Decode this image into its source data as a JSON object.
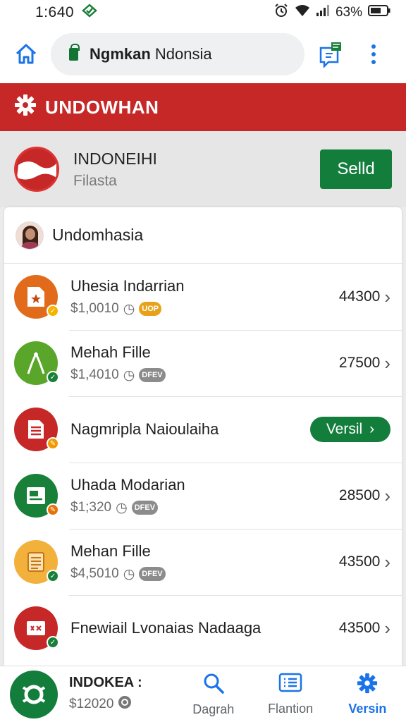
{
  "status_bar": {
    "time": "1:640",
    "battery": "63%",
    "icons": [
      "wifi-icon",
      "signal-icon",
      "alarm-icon",
      "battery-icon"
    ]
  },
  "browser": {
    "url_bold": "Ngmkan",
    "url_rest": " Ndonsia",
    "icons": [
      "home-icon",
      "lock-icon",
      "chat-icon",
      "more-vert-icon"
    ]
  },
  "header": {
    "title": "UNDOWHAN",
    "icon": "gear-icon",
    "color": "#c62828"
  },
  "profile": {
    "name": "INDONEIHI",
    "subtitle": "Filasta",
    "button": "Selld"
  },
  "list": {
    "heading": "Undomhasia",
    "rows": [
      {
        "title": "Uhesia Indarrian",
        "price": "$1,0010",
        "amount": "44300",
        "chip": "UOP",
        "icon_color": "#e26a1b",
        "badge_color": "#f4b400"
      },
      {
        "title": "Mehah Fille",
        "price": "$1,4010",
        "amount": "27500",
        "chip": "DFEV",
        "icon_color": "#5aa62a",
        "badge_color": "#188038"
      },
      {
        "title": "Nagmripla Naioulaiha",
        "action": "Versil",
        "icon_color": "#c62828",
        "badge_color": "#f29900"
      },
      {
        "title": "Uhada Modarian",
        "price": "$1;320",
        "amount": "28500",
        "chip": "DFEV",
        "icon_color": "#188038",
        "badge_color": "#e8710a"
      },
      {
        "title": "Mehan Fille",
        "price": "$4,5010",
        "amount": "43500",
        "chip": "DFEV",
        "icon_color": "#f2b13a",
        "badge_color": "#188038"
      },
      {
        "title": "Fnewiail Lvonaias Nadaaga",
        "amount": "43500",
        "icon_color": "#c62828",
        "badge_color": "#188038"
      }
    ]
  },
  "bottom_nav": {
    "name": "INDOKEA :",
    "value": "$12020",
    "items": [
      {
        "label": "Dagrah",
        "icon": "search-icon"
      },
      {
        "label": "Flantion",
        "icon": "list-icon"
      },
      {
        "label": "Versin",
        "icon": "gear-icon",
        "active": true
      }
    ]
  }
}
